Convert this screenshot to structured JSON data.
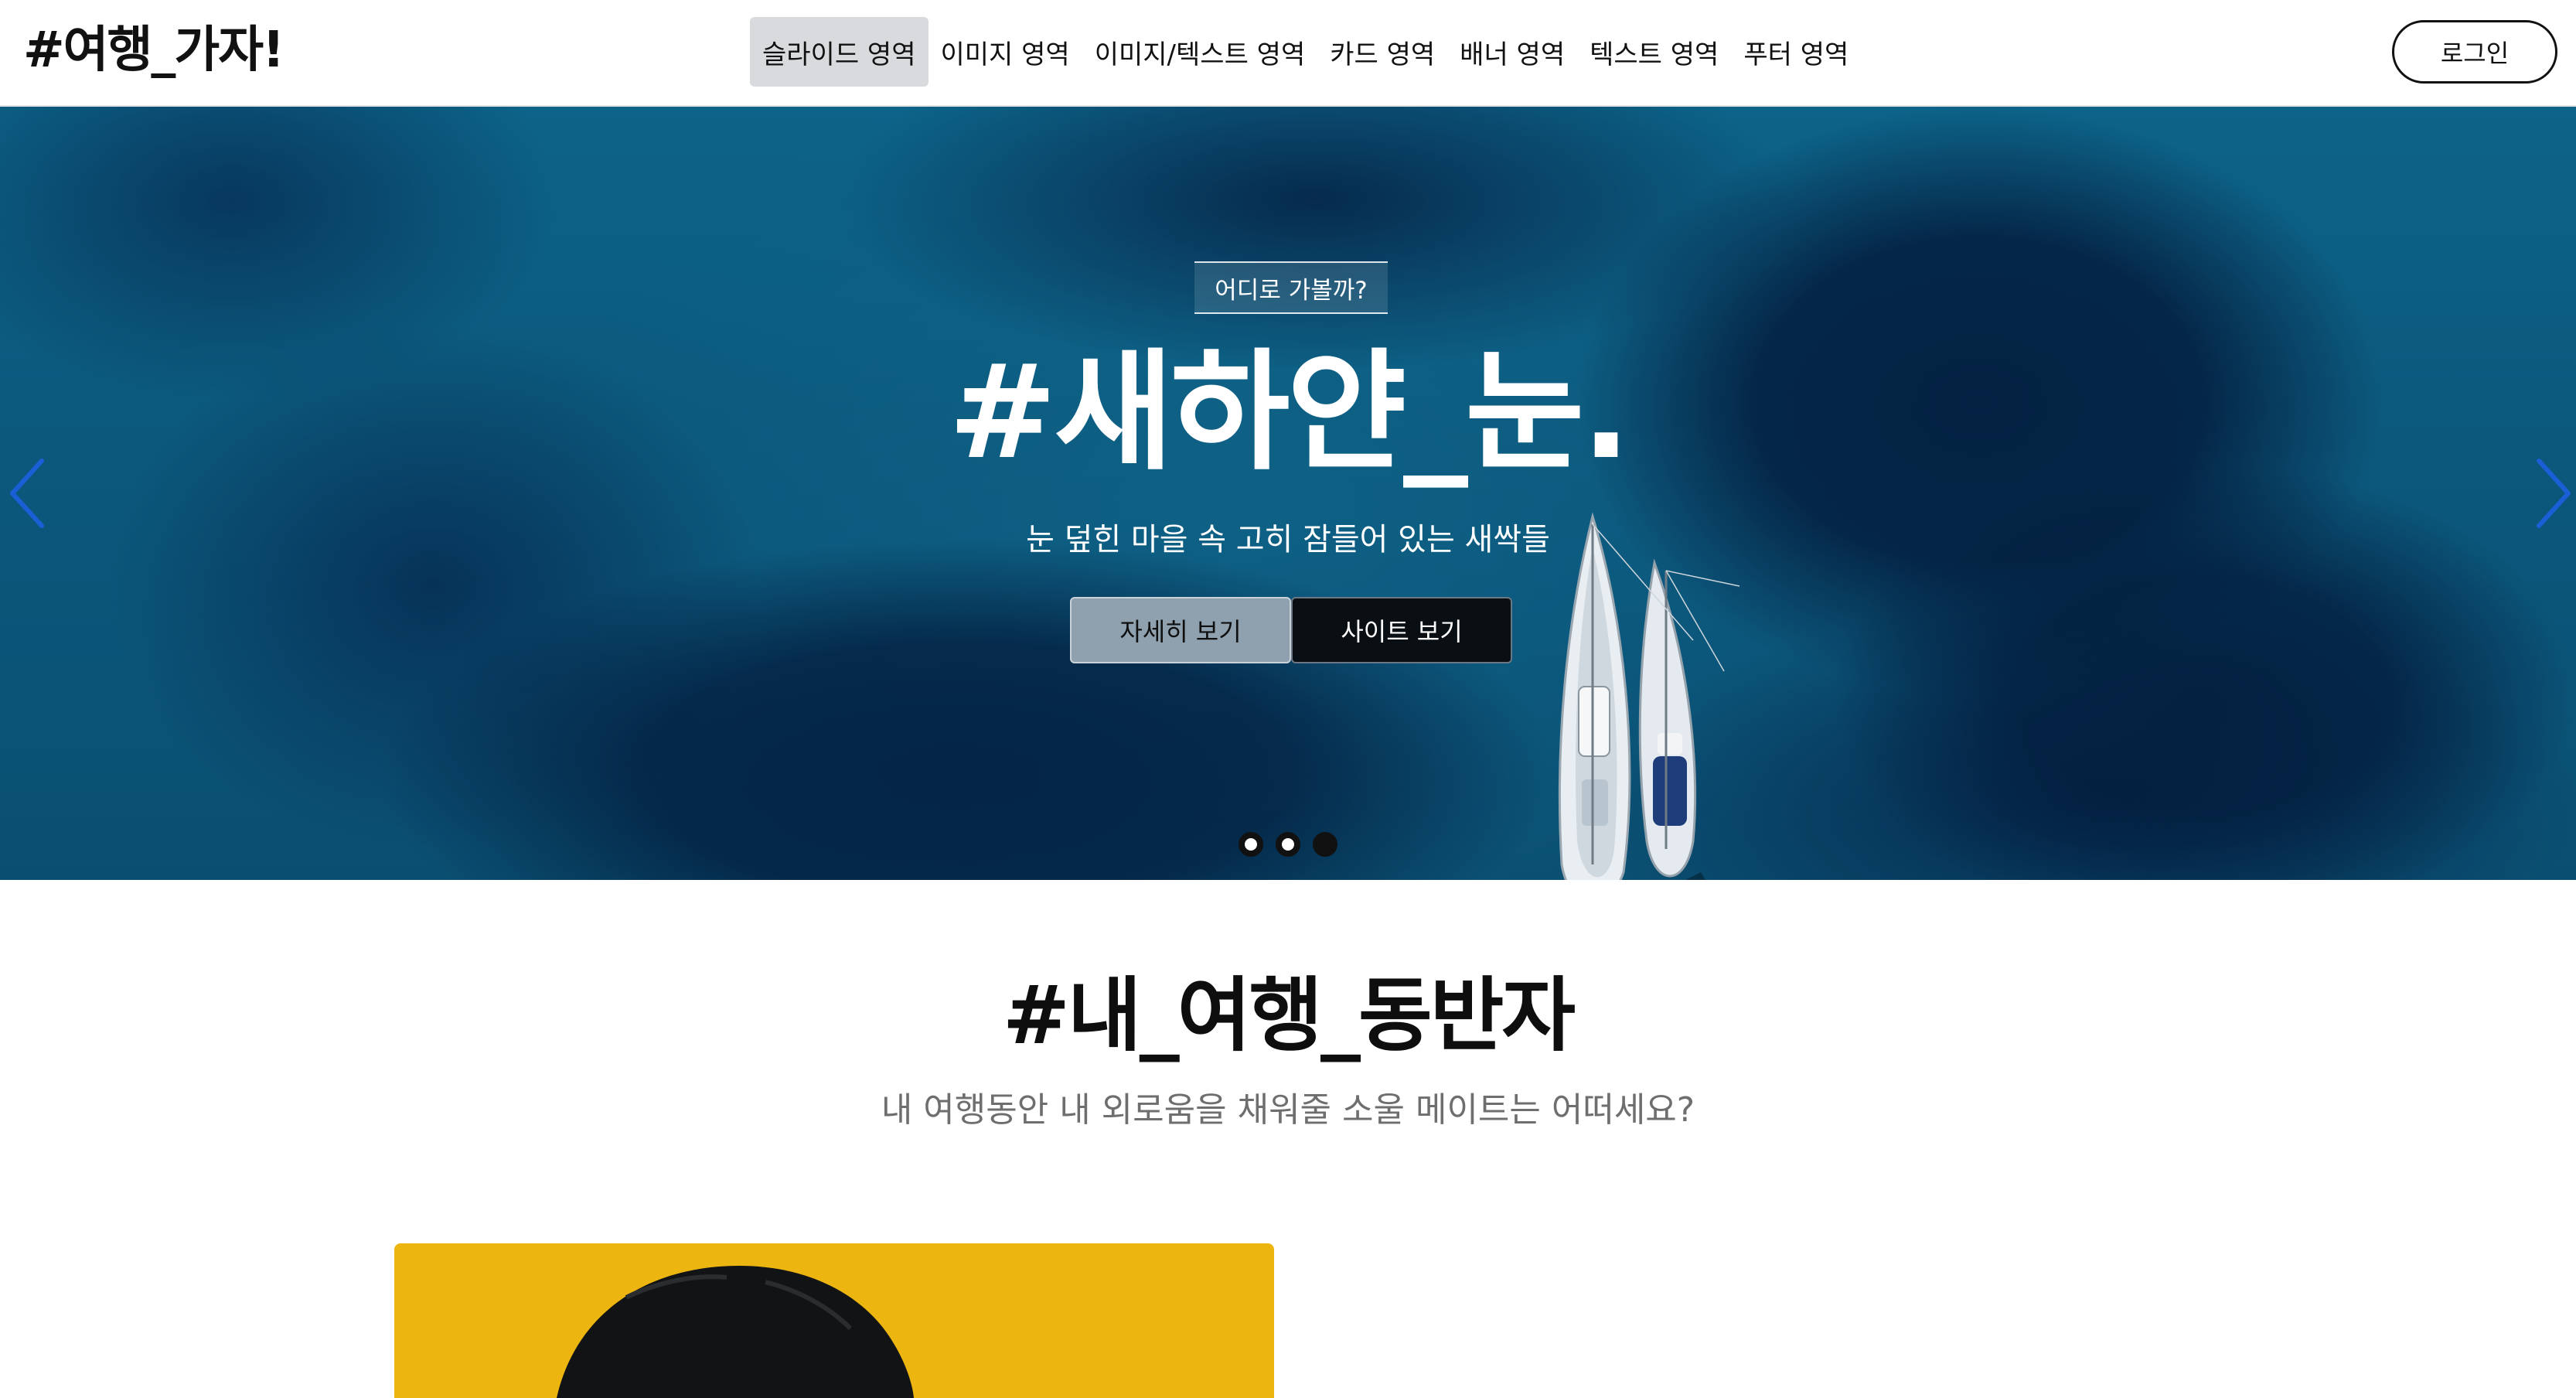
{
  "header": {
    "logo": "#여행_가자!",
    "nav": [
      {
        "label": "슬라이드 영역",
        "active": true
      },
      {
        "label": "이미지 영역",
        "active": false
      },
      {
        "label": "이미지/텍스트 영역",
        "active": false
      },
      {
        "label": "카드 영역",
        "active": false
      },
      {
        "label": "배너 영역",
        "active": false
      },
      {
        "label": "텍스트 영역",
        "active": false
      },
      {
        "label": "푸터 영역",
        "active": false
      }
    ],
    "login_label": "로그인"
  },
  "hero": {
    "tag": "어디로 가볼까?",
    "title": "#새하얀_눈.",
    "subtitle": "눈 덮힌 마을 속 고히 잠들어 있는 새싹들",
    "detail_button": "자세히 보기",
    "site_button": "사이트 보기",
    "slide_count": 3,
    "active_slide": 3,
    "colors": {
      "arrow": "#1a5fd6",
      "sea": "#0f6a92"
    }
  },
  "section": {
    "title": "#내_여행_동반자",
    "subtitle": "내 여행동안 내 외로움을 채워줄 소울 메이트는 어떠세요?",
    "card_color": "#ecb50f"
  }
}
